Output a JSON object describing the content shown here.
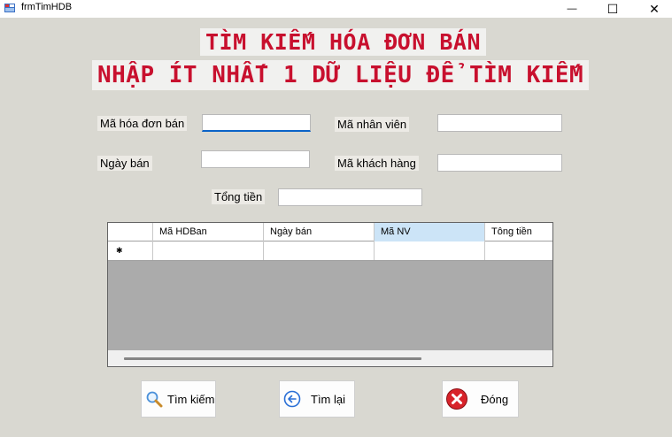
{
  "window": {
    "title": "frmTimHDB",
    "minimize_glyph": "—",
    "maximize_glyph": "☐",
    "close_glyph": "✕"
  },
  "banner": {
    "line1": "TÌM KIẾM HÓA ĐƠN BÁN",
    "line2": "NHẬP ÍT NHẤT 1 DỮ LIỆU ĐỂ TÌM KIẾM"
  },
  "form": {
    "ma_hdb_label": "Mã hóa đơn bán",
    "ma_hdb_value": "",
    "ma_nv_label": "Mã nhân viên",
    "ma_nv_value": "",
    "ngay_ban_label": "Ngày bán",
    "ngay_ban_value": "",
    "ma_kh_label": "Mã khách hàng",
    "ma_kh_value": "",
    "tong_tien_label": "Tổng tiền",
    "tong_tien_value": ""
  },
  "grid": {
    "columns": [
      "Mã HDBan",
      "Ngày bán",
      "Mã NV",
      "Tông tiền"
    ],
    "selected_column": 2,
    "new_row_marker": "✱"
  },
  "buttons": {
    "search": "Tìm kiếm",
    "reset": "Tìm lại",
    "close": "Đóng"
  },
  "colors": {
    "banner_text": "#c8102e",
    "form_bg": "#d9d8d1",
    "grid_bg": "#ababab",
    "focus_accent": "#0b63c8"
  },
  "icons": {
    "search": "magnifier-icon",
    "reset": "back-arrow-icon",
    "close": "red-x-icon"
  }
}
